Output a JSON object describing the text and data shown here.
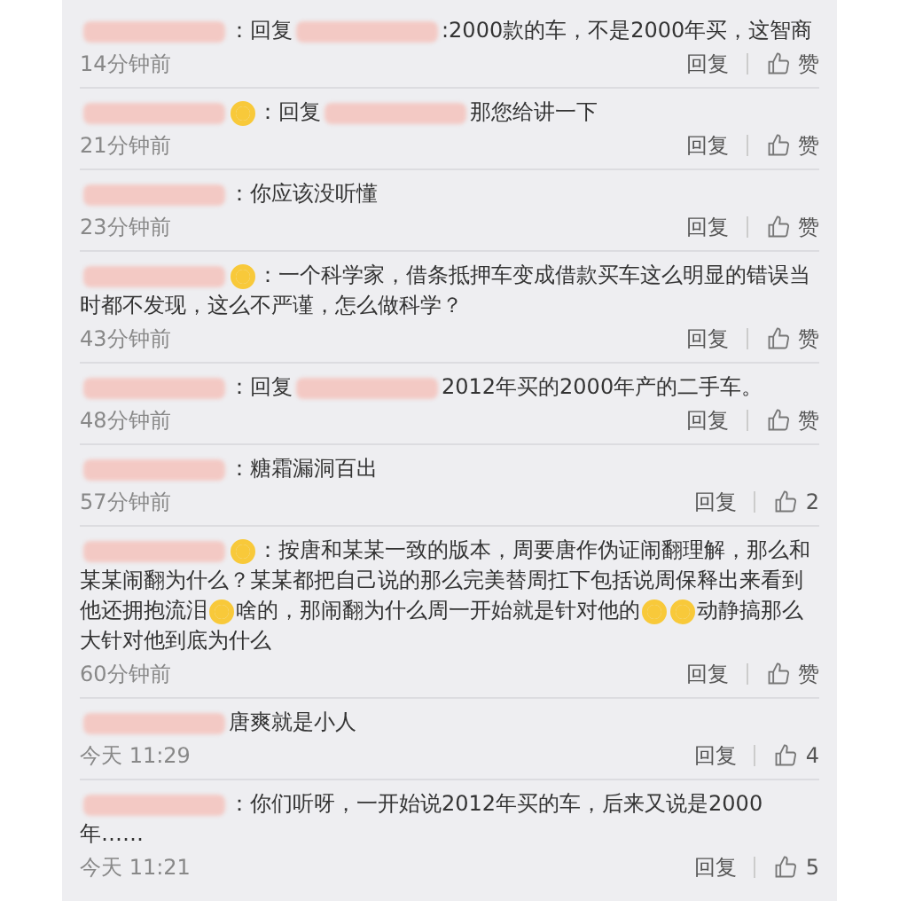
{
  "comments": [
    {
      "parts": [
        {
          "kind": "hidden"
        },
        {
          "kind": "text",
          "text": "：回复"
        },
        {
          "kind": "hidden"
        },
        {
          "kind": "text",
          "text": ":2000款的车，不是2000年买，这智商"
        }
      ],
      "time": "14分钟前",
      "reply": "回复",
      "like": "赞"
    },
    {
      "parts": [
        {
          "kind": "hidden"
        },
        {
          "kind": "emoji"
        },
        {
          "kind": "text",
          "text": "：回复"
        },
        {
          "kind": "hidden"
        },
        {
          "kind": "text",
          "text": "那您给讲一下"
        }
      ],
      "time": "21分钟前",
      "reply": "回复",
      "like": "赞"
    },
    {
      "parts": [
        {
          "kind": "hidden"
        },
        {
          "kind": "text",
          "text": "：你应该没听懂"
        }
      ],
      "time": "23分钟前",
      "reply": "回复",
      "like": "赞"
    },
    {
      "parts": [
        {
          "kind": "hidden"
        },
        {
          "kind": "emoji"
        },
        {
          "kind": "text",
          "text": "：一个科学家，借条抵押车变成借款买车这么明显的错误当时都不发现，这么不严谨，怎么做科学？"
        }
      ],
      "time": "43分钟前",
      "reply": "回复",
      "like": "赞"
    },
    {
      "parts": [
        {
          "kind": "hidden"
        },
        {
          "kind": "text",
          "text": "：回复"
        },
        {
          "kind": "hidden"
        },
        {
          "kind": "text",
          "text": "2012年买的2000年产的二手车。"
        }
      ],
      "time": "48分钟前",
      "reply": "回复",
      "like": "赞"
    },
    {
      "parts": [
        {
          "kind": "hidden"
        },
        {
          "kind": "text",
          "text": "：糖霜漏洞百出"
        }
      ],
      "time": "57分钟前",
      "reply": "回复",
      "like": "2"
    },
    {
      "parts": [
        {
          "kind": "hidden"
        },
        {
          "kind": "emoji"
        },
        {
          "kind": "text",
          "text": "：按唐和某某一致的版本，周要唐作伪证闹翻理解，那么和某某闹翻为什么？某某都把自己说的那么完美替周扛下包括说周保释出来看到他还拥抱流泪"
        },
        {
          "kind": "emoji"
        },
        {
          "kind": "text",
          "text": "啥的，那闹翻为什么周一开始就是针对他的"
        },
        {
          "kind": "emoji"
        },
        {
          "kind": "emoji"
        },
        {
          "kind": "text",
          "text": "动静搞那么大针对他到底为什么"
        }
      ],
      "time": "60分钟前",
      "reply": "回复",
      "like": "赞"
    },
    {
      "parts": [
        {
          "kind": "hidden"
        },
        {
          "kind": "text",
          "text": "唐爽就是小人"
        }
      ],
      "time": "今天 11:29",
      "reply": "回复",
      "like": "4"
    },
    {
      "parts": [
        {
          "kind": "hidden"
        },
        {
          "kind": "text",
          "text": "：你们听呀，一开始说2012年买的车，后来又说是2000年……"
        }
      ],
      "time": "今天 11:21",
      "reply": "回复",
      "like": "5"
    }
  ]
}
